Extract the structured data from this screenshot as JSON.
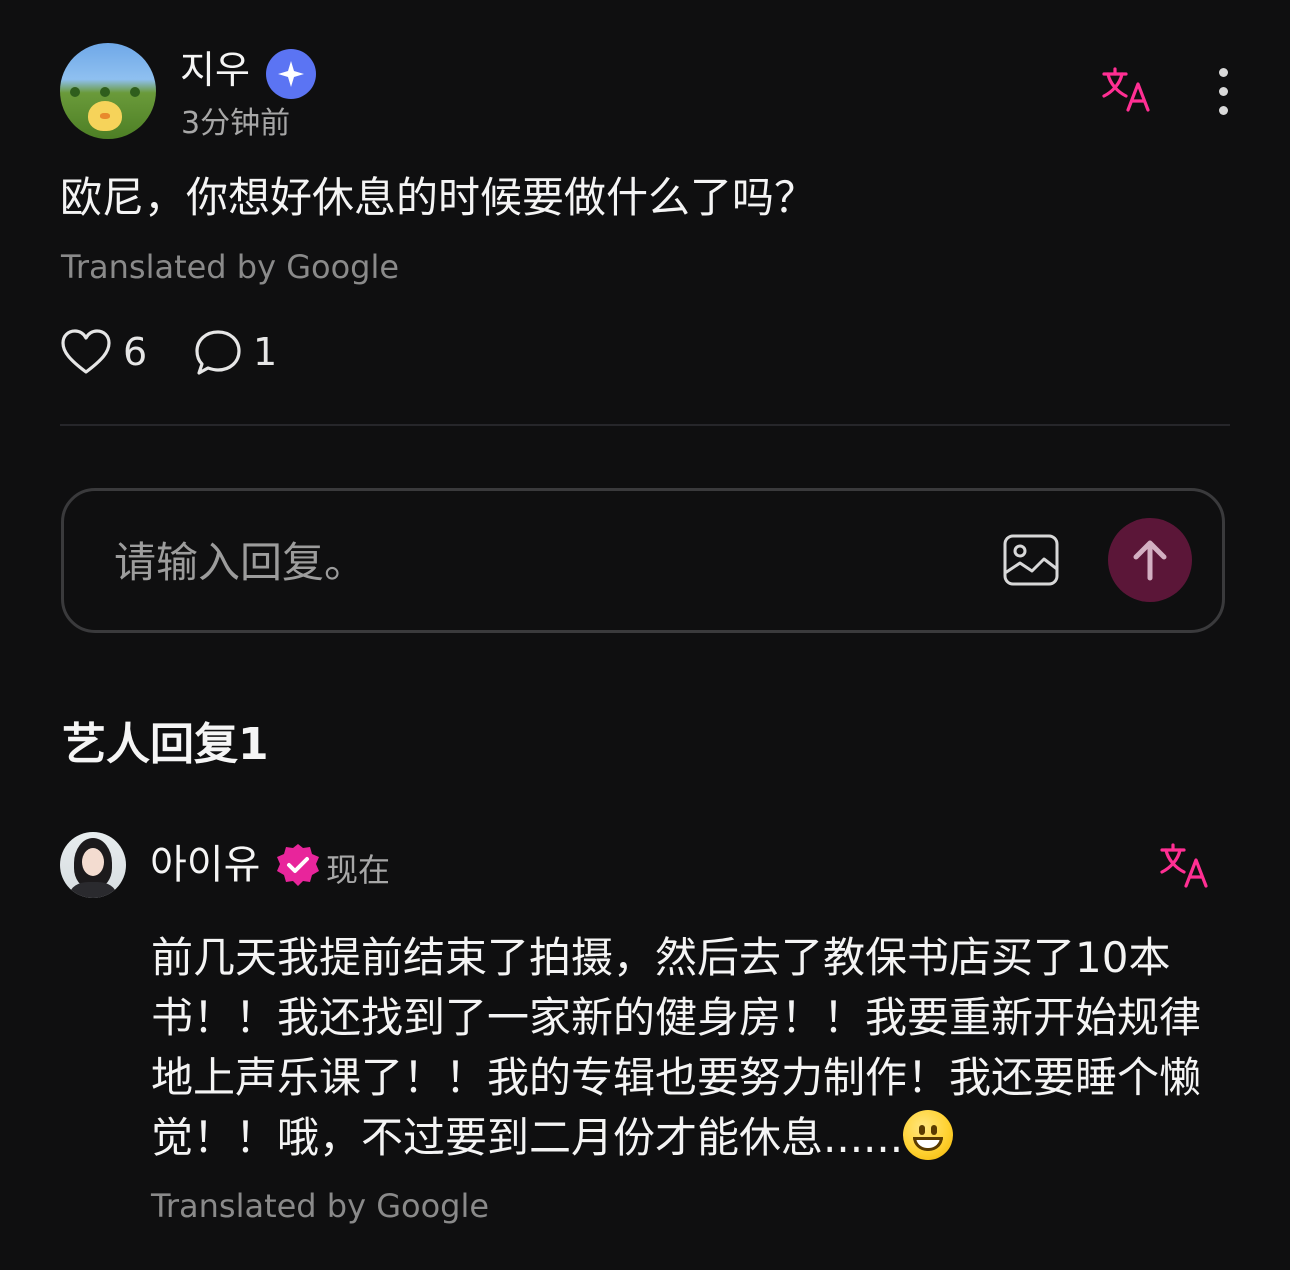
{
  "post": {
    "username": "지우",
    "timestamp": "3分钟前",
    "text": "欧尼，你想好休息的时候要做什么了吗？",
    "translated_by": "Translated by Google",
    "likes": "6",
    "comments": "1"
  },
  "reply_input": {
    "placeholder": "请输入回复。"
  },
  "section": {
    "title": "艺人回复1"
  },
  "artist_reply": {
    "username": "아이유",
    "timestamp": "现在",
    "text": "前几天我提前结束了拍摄，然后去了教保书店买了10本书！！我还找到了一家新的健身房！！我要重新开始规律地上声乐课了！！我的专辑也要努力制作！我还要睡个懒觉！！哦，不过要到二月份才能休息......",
    "emoji": "grinning-face",
    "translated_by": "Translated by Google"
  },
  "colors": {
    "background": "#0f0f10",
    "accent_pink": "#ff2f93",
    "verified_blue": "#5b74f3",
    "verified_pink": "#e8259b",
    "send_button": "#5b1638"
  }
}
